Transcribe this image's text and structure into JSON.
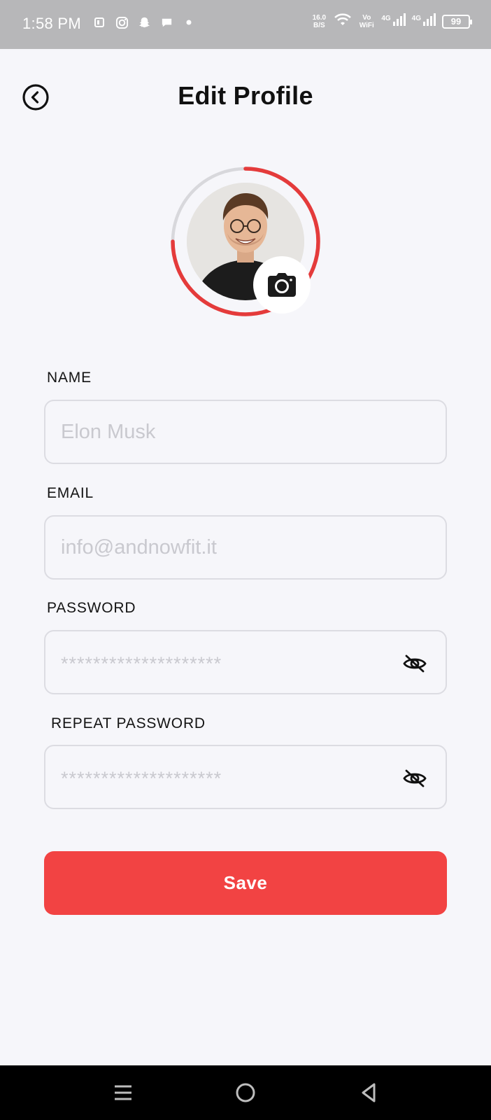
{
  "status_bar": {
    "time": "1:58 PM",
    "net_speed_value": "16.0",
    "net_speed_unit": "B/S",
    "vowifi_top": "Vo",
    "vowifi_bottom": "WiFi",
    "net1": "4G",
    "net2": "4G",
    "battery": "99",
    "icons": [
      "pdf-icon",
      "instagram-icon",
      "snapchat-icon",
      "chat-icon",
      "dot-icon",
      "wifi-icon",
      "signal-icon",
      "battery-icon"
    ]
  },
  "header": {
    "title": "Edit Profile",
    "back_icon": "chevron-left-circle-icon"
  },
  "avatar": {
    "camera_icon": "camera-icon",
    "ring_color": "#e43b3b",
    "ring_track_color": "#d8d8dc"
  },
  "form": {
    "name": {
      "label": "NAME",
      "placeholder": "Elon Musk"
    },
    "email": {
      "label": "EMAIL",
      "placeholder": "info@andnowfit.it"
    },
    "password": {
      "label": "PASSWORD",
      "mask": "********************",
      "toggle_icon": "eye-off-icon"
    },
    "repeat_password": {
      "label": "REPEAT PASSWORD",
      "mask": "********************",
      "toggle_icon": "eye-off-icon"
    }
  },
  "save_button": {
    "label": "Save",
    "color": "#f24343"
  },
  "nav_bar": {
    "items": [
      "menu-icon",
      "home-circle-icon",
      "back-triangle-icon"
    ]
  }
}
